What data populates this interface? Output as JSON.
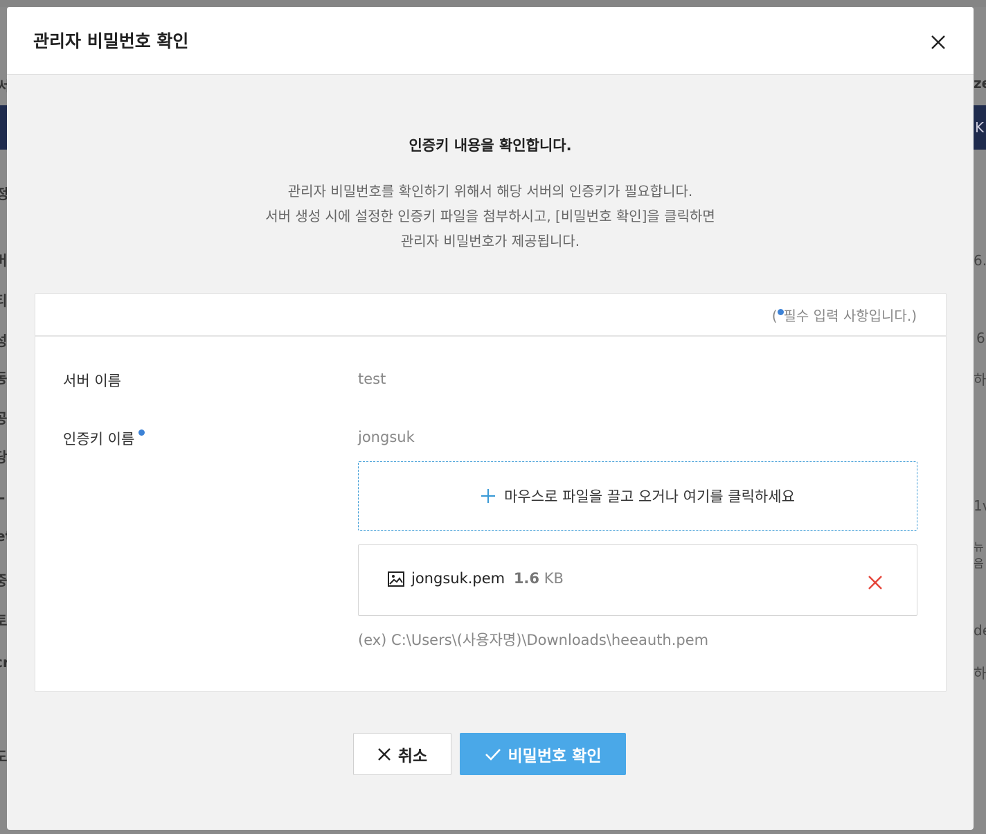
{
  "modal": {
    "title": "관리자 비밀번호 확인",
    "intro_title": "인증키 내용을 확인합니다.",
    "intro_lines": [
      "관리자 비밀번호를 확인하기 위해서 해당 서버의 인증키가 필요합니다.",
      "서버 생성 시에 설정한 인증키 파일을 첨부하시고, [비밀번호 확인]을 클릭하면",
      "관리자 비밀번호가 제공됩니다."
    ],
    "required_note_prefix": "(",
    "required_note_text": "필수 입력 사항입니다.)",
    "form": {
      "server_name_label": "서버 이름",
      "server_name_value": "test",
      "auth_key_label": "인증키 이름",
      "auth_key_value": "jongsuk",
      "dropzone_text": "마우스로 파일을 끌고 오거나 여기를 클릭하세요",
      "file": {
        "name": "jongsuk.pem",
        "size_value": "1.6",
        "size_unit": "KB"
      },
      "path_hint": "(ex) C:\\Users\\(사용자명)\\Downloads\\heeauth.pem"
    },
    "buttons": {
      "cancel": "취소",
      "confirm": "비밀번호 확인"
    }
  },
  "colors": {
    "accent": "#4aa8e8",
    "required_dot": "#3c82d6",
    "remove_icon": "#e5453a",
    "dropzone_border": "#3c9bd6"
  },
  "background_fragments": [
    "서",
    "K",
    "정.",
    "버",
    "티",
    "성",
    "동",
    "공",
    "당",
    "L",
    "et",
    "중",
    "토",
    "cr",
    "도",
    "ze",
    "6.",
    "6",
    "하",
    "1v",
    "뉴음",
    "de",
    "하"
  ]
}
